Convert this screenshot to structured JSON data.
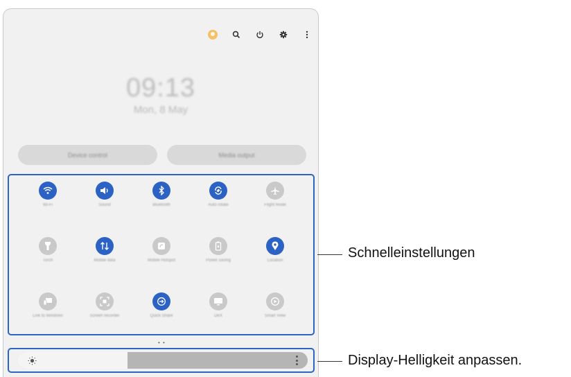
{
  "status_icons": [
    {
      "name": "account-icon"
    },
    {
      "name": "search-icon"
    },
    {
      "name": "power-icon"
    },
    {
      "name": "settings-icon"
    },
    {
      "name": "more-options-icon"
    }
  ],
  "clock": {
    "time": "09:13",
    "date": "Mon, 8 May"
  },
  "buttons": {
    "device_control": "Device control",
    "media_output": "Media output"
  },
  "quick_settings": {
    "tiles": [
      {
        "label": "Wi-Fi",
        "icon": "wifi-icon",
        "active": true
      },
      {
        "label": "Sound",
        "icon": "sound-icon",
        "active": true
      },
      {
        "label": "Bluetooth",
        "icon": "bluetooth-icon",
        "active": true
      },
      {
        "label": "Auto rotate",
        "icon": "auto-rotate-icon",
        "active": true
      },
      {
        "label": "Flight mode",
        "icon": "airplane-icon",
        "active": false
      },
      {
        "label": "Torch",
        "icon": "flashlight-icon",
        "active": false
      },
      {
        "label": "Mobile data",
        "icon": "mobile-data-icon",
        "active": true
      },
      {
        "label": "Mobile Hotspot",
        "icon": "hotspot-icon",
        "active": false
      },
      {
        "label": "Power saving",
        "icon": "power-saving-icon",
        "active": false
      },
      {
        "label": "Location",
        "icon": "location-icon",
        "active": true
      },
      {
        "label": "Link to Windows",
        "icon": "link-windows-icon",
        "active": false
      },
      {
        "label": "Screen recorder",
        "icon": "screen-recorder-icon",
        "active": false
      },
      {
        "label": "Quick Share",
        "icon": "quick-share-icon",
        "active": true
      },
      {
        "label": "DeX",
        "icon": "dex-icon",
        "active": false
      },
      {
        "label": "Smart View",
        "icon": "smart-view-icon",
        "active": false
      }
    ]
  },
  "page_indicator": "• •",
  "brightness": {
    "level": 0.38,
    "icon": "sun-icon"
  },
  "callouts": {
    "quick_settings": "Schnelleinstellungen",
    "brightness": "Display-Helligkeit anpassen."
  }
}
